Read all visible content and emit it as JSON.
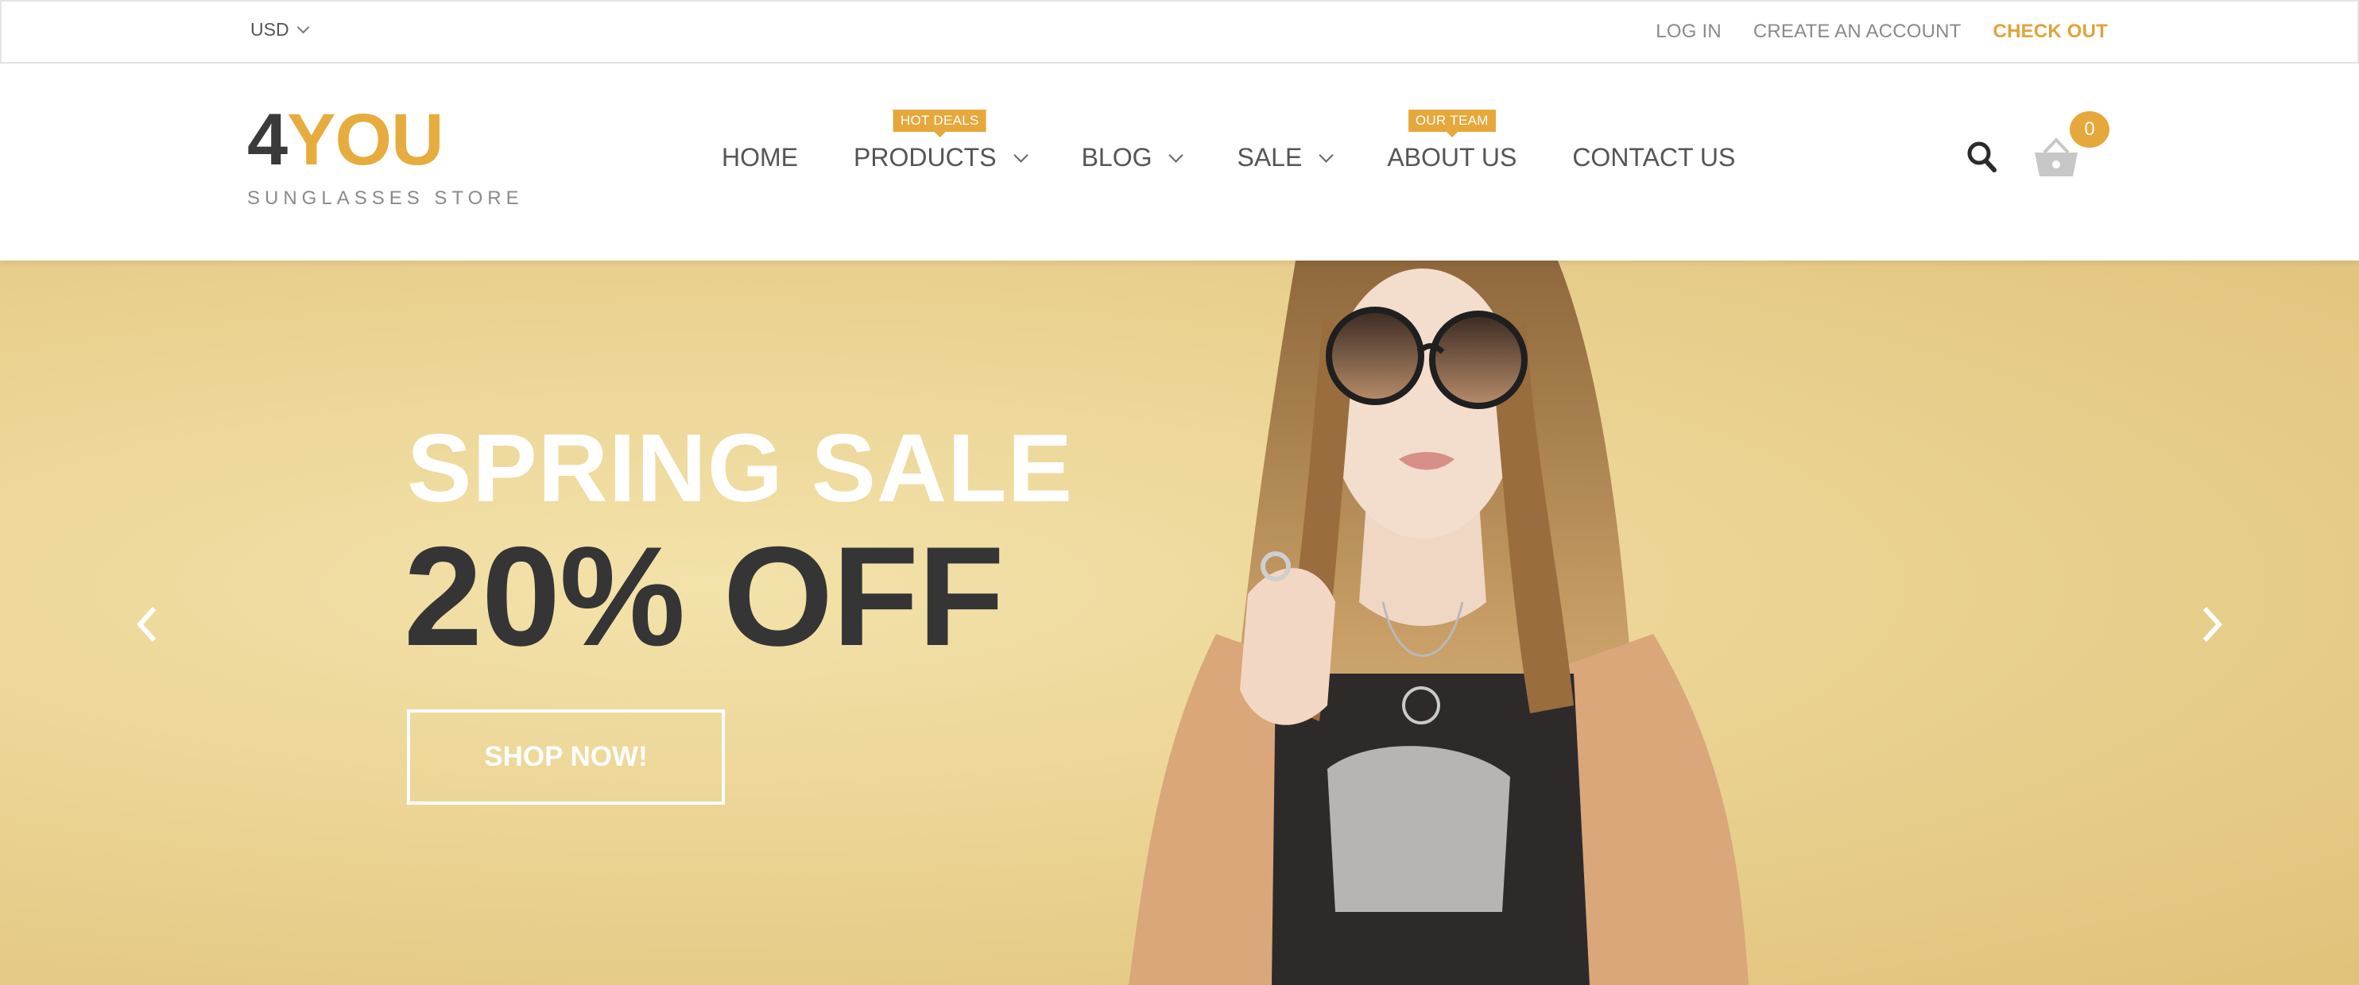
{
  "topbar": {
    "currency": "USD",
    "links": {
      "login": "LOG IN",
      "create_account": "CREATE AN ACCOUNT",
      "checkout": "CHECK OUT"
    }
  },
  "header": {
    "logo": {
      "num": "4",
      "word": "YOU",
      "tagline": "SUNGLASSES STORE"
    },
    "nav": {
      "home": "HOME",
      "products": "PRODUCTS",
      "products_badge": "HOT DEALS",
      "blog": "BLOG",
      "sale": "SALE",
      "about": "ABOUT US",
      "about_badge": "OUR TEAM",
      "contact": "CONTACT US"
    },
    "cart_count": "0"
  },
  "hero": {
    "title": "SPRING SALE",
    "subtitle": "20% OFF",
    "button": "SHOP NOW!"
  },
  "icons": {
    "currency": "chevron-down-icon",
    "search": "search-icon",
    "cart": "basket-icon",
    "prev": "chevron-left-icon",
    "next": "chevron-right-icon"
  },
  "colors": {
    "accent": "#e6ac3e",
    "dark": "#353535",
    "hero_bg": "#ecd596"
  }
}
